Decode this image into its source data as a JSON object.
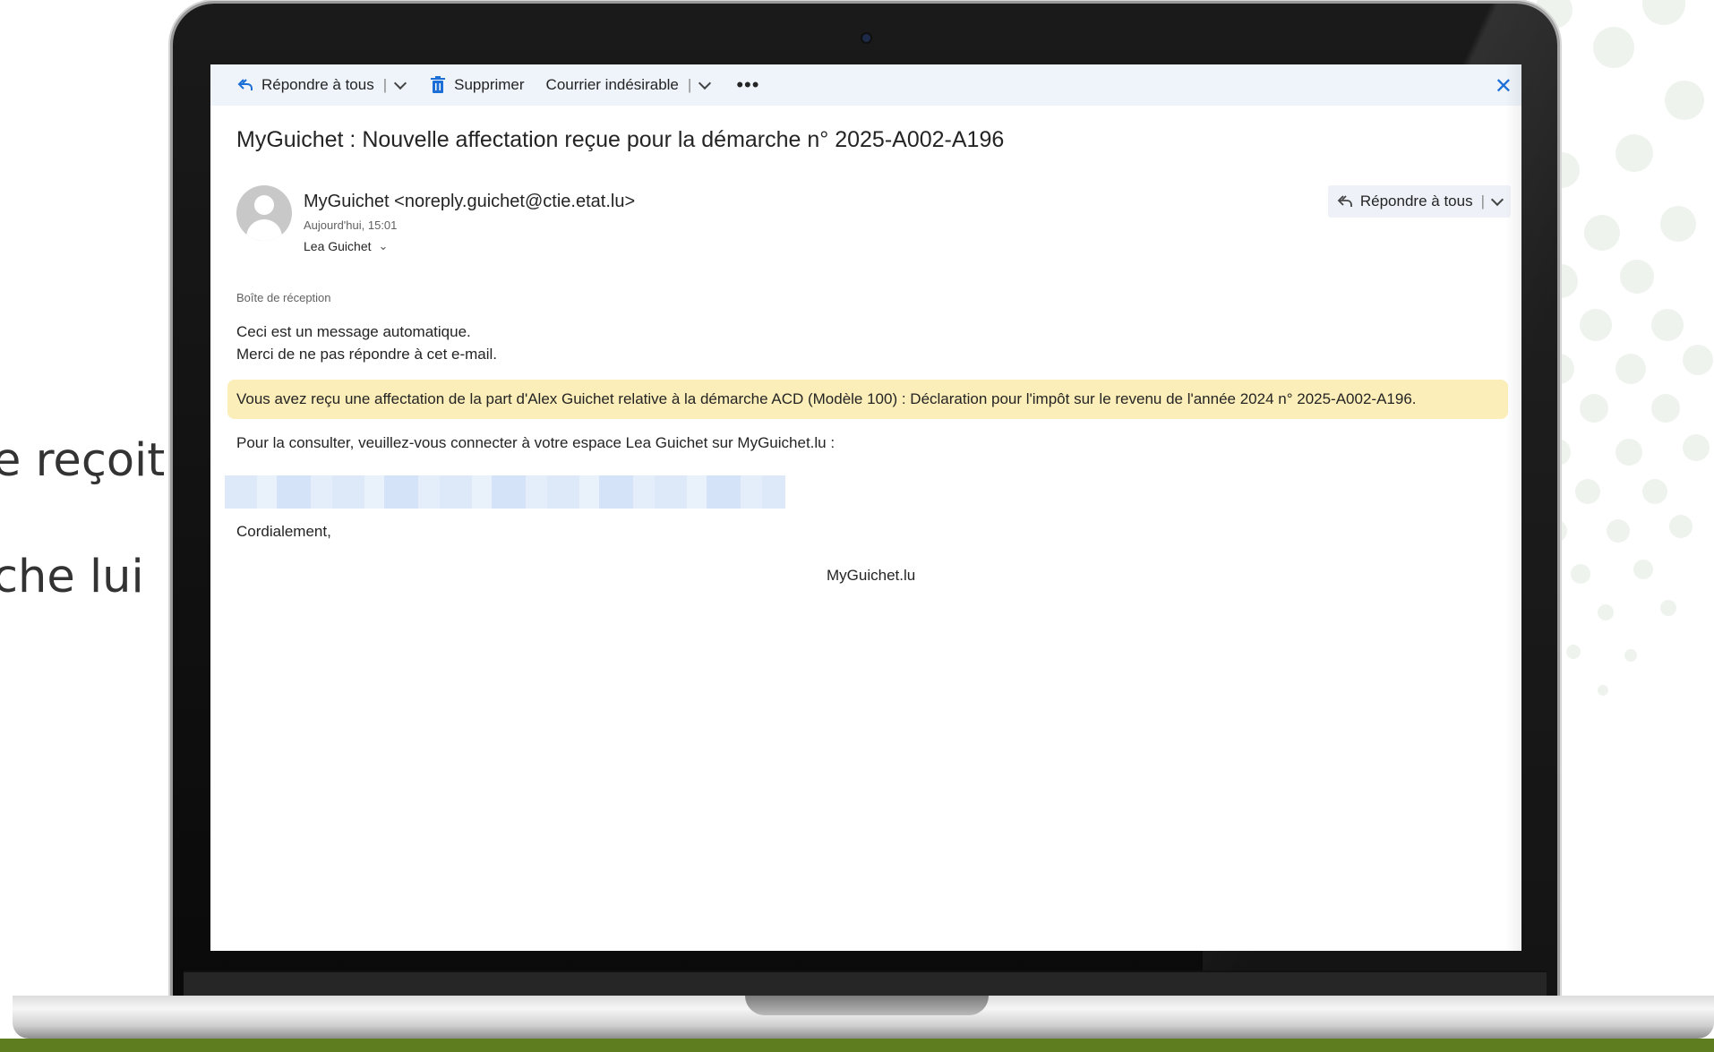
{
  "slide": {
    "side_text_1": "e reçoit",
    "side_text_2": "che lui"
  },
  "toolbar": {
    "reply_all_label": "Répondre à tous",
    "delete_label": "Supprimer",
    "junk_label": "Courrier indésirable",
    "more_label": "•••",
    "close_label": "✕"
  },
  "email": {
    "subject": "MyGuichet : Nouvelle affectation reçue pour la démarche n° 2025-A002-A196",
    "sender": "MyGuichet <noreply.guichet@ctie.etat.lu>",
    "date": "Aujourd'hui, 15:01",
    "to": "Lea Guichet",
    "reply_all_button": "Répondre à tous",
    "folder": "Boîte de réception",
    "body": {
      "line1": "Ceci est un message automatique.",
      "line2": "Merci de ne pas répondre à cet e-mail.",
      "highlight": "Vous avez reçu une affectation de la part d'Alex Guichet relative à la démarche ACD (Modèle 100) : Déclaration pour l'impôt sur le revenu de l'année 2024 n° 2025-A002-A196.",
      "line3": "Pour la consulter, veuillez-vous connecter à votre espace Lea Guichet sur MyGuichet.lu :",
      "closing": "Cordialement,",
      "signature": "MyGuichet.lu"
    }
  },
  "colors": {
    "accent": "#1b6fd6",
    "toolbar_bg": "#eff4fb",
    "highlight_bg": "#fbeeb8",
    "brand_green": "#5e7d1e"
  }
}
